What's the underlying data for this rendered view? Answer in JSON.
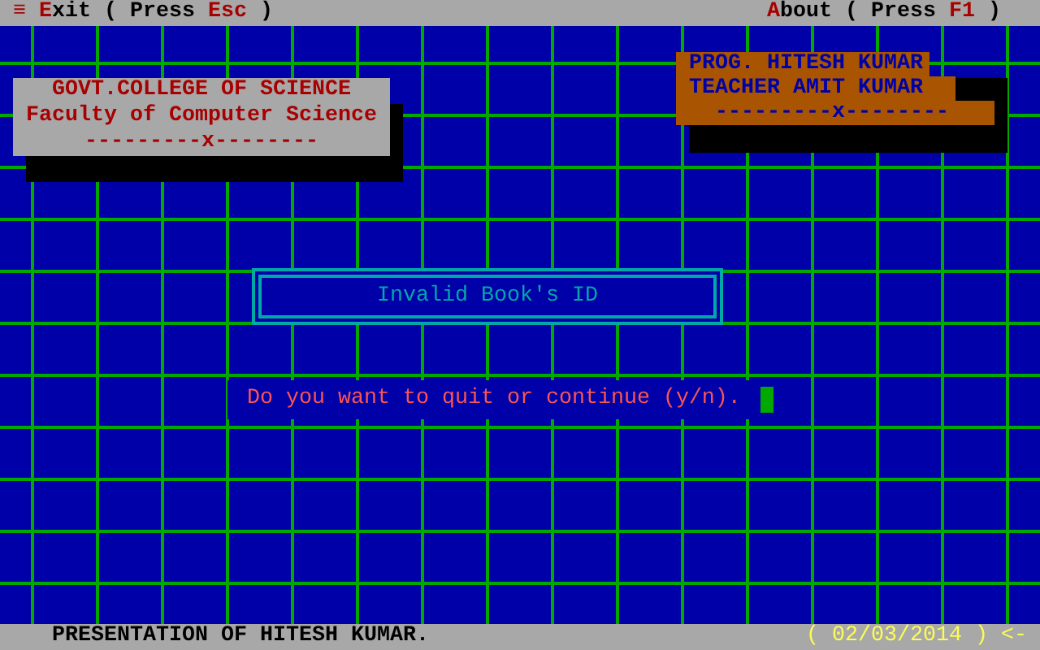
{
  "menu_bar": {
    "items": [
      {
        "icon": "≡",
        "hotkey": "E",
        "label": "xit ( Press ",
        "key": "Esc",
        "suffix": " )"
      },
      {
        "hotkey": "A",
        "label": "bout ( Press ",
        "key": "F1",
        "suffix": " )"
      }
    ]
  },
  "college_card": {
    "lines": [
      "GOVT.COLLEGE OF SCIENCE",
      "Faculty of Computer Science",
      "---------x--------"
    ]
  },
  "credits_card": {
    "lines": [
      "PROG. HITESH KUMAR",
      "TEACHER AMIT KUMAR",
      "---------x--------"
    ]
  },
  "dialog": {
    "message": "Invalid Book's ID"
  },
  "prompt": {
    "text": "Do you want to quit or continue (y/n).",
    "cursor": true
  },
  "status_bar": {
    "text": "PRESENTATION OF HITESH KUMAR.",
    "date": "( 02/03/2014 ) <-"
  }
}
